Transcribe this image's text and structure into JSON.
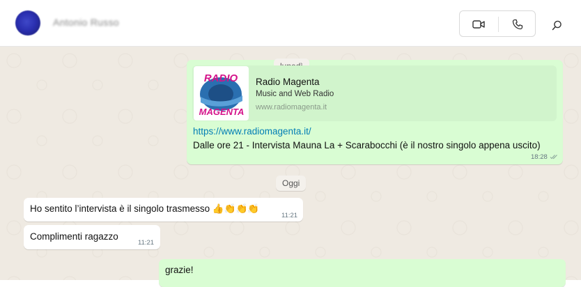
{
  "header": {
    "contact_name": "Antonio Russo",
    "icons": [
      "avatar",
      "video-call-icon",
      "voice-call-icon",
      "search-icon"
    ]
  },
  "chat": {
    "date_separators": [
      "lunedì",
      "Oggi"
    ],
    "link_preview": {
      "logo_text_top": "RADIO",
      "logo_text_bottom": "MAGENTA",
      "title": "Radio Magenta",
      "description": "Music and Web Radio",
      "domain": "www.radiomagenta.it"
    },
    "messages": [
      {
        "direction": "out",
        "link": "https://www.radiomagenta.it/",
        "text": "Dalle ore 21 - Intervista Mauna La + Scarabocchi (è il nostro singolo appena uscito)",
        "time": "18:28",
        "status": "read"
      },
      {
        "direction": "in",
        "text": "Ho sentito l’intervista è il singolo trasmesso 👍👏👏👏",
        "time": "11:21"
      },
      {
        "direction": "in",
        "text": "Complimenti ragazzo",
        "time": "11:21"
      },
      {
        "direction": "out",
        "text": "grazie!"
      }
    ]
  }
}
